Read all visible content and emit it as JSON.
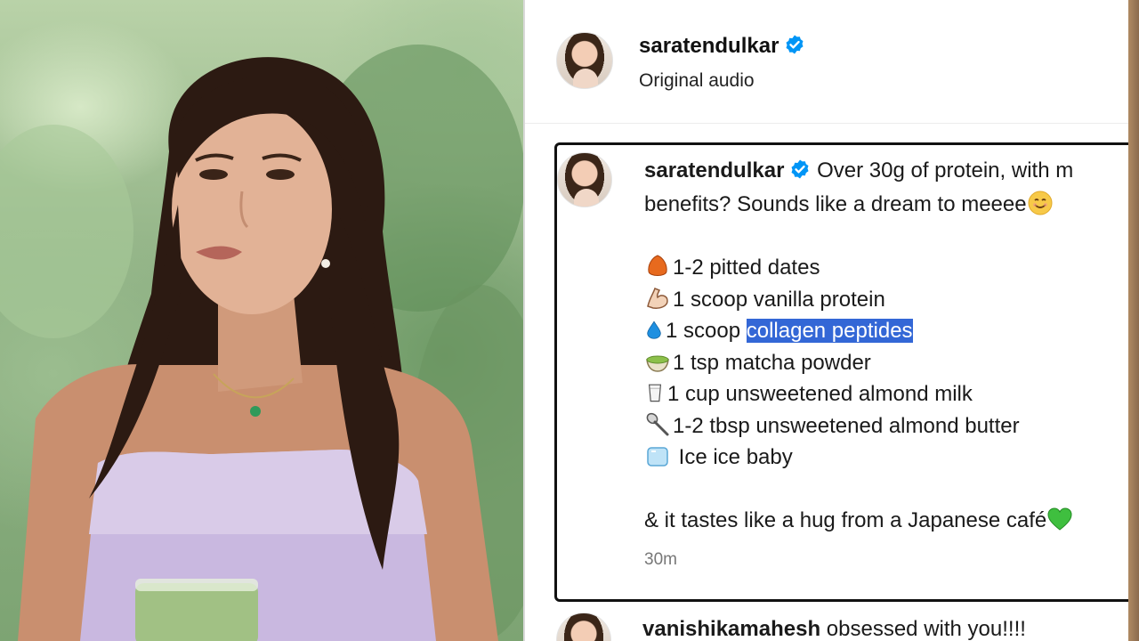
{
  "post": {
    "username": "saratendulkar",
    "audio_label": "Original audio"
  },
  "caption": {
    "username": "saratendulkar",
    "line1": "Over 30g of protein, with m",
    "line2": "benefits? Sounds like a dream to meeee",
    "ingredients": [
      {
        "icon": "date-emoji-icon",
        "text": "1-2 pitted dates"
      },
      {
        "icon": "flexed-biceps-emoji-icon",
        "text": "1 scoop vanilla protein"
      },
      {
        "icon": "droplet-emoji-icon",
        "prefix": "1 scoop ",
        "highlight": "collagen peptides"
      },
      {
        "icon": "matcha-bowl-emoji-icon",
        "text": "1 tsp matcha powder"
      },
      {
        "icon": "milk-glass-emoji-icon",
        "text": "1 cup unsweetened almond milk"
      },
      {
        "icon": "spoon-emoji-icon",
        "text": "1-2 tbsp unsweetened almond butter"
      },
      {
        "icon": "ice-cube-emoji-icon",
        "text": " Ice ice baby"
      }
    ],
    "closing": "& it tastes like a hug from a Japanese café",
    "timestamp": "30m"
  },
  "comment": {
    "username": "vanishikamahesh",
    "text": "obsessed with you!!!!"
  },
  "colors": {
    "verified_blue": "#0095f6",
    "selection": "#3367d6",
    "heart_green": "#3fbf3f"
  }
}
